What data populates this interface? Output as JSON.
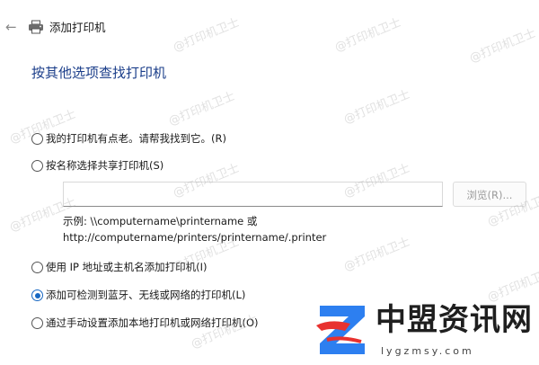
{
  "header": {
    "back_icon": "back-arrow-icon",
    "window_icon": "printer-icon",
    "title": "添加打印机"
  },
  "page_title": "按其他选项查找打印机",
  "options": [
    {
      "label": "我的打印机有点老。请帮我找到它。(R)",
      "checked": false
    },
    {
      "label": "按名称选择共享打印机(S)",
      "checked": false
    },
    {
      "label": "使用 IP 地址或主机名添加打印机(I)",
      "checked": false
    },
    {
      "label": "添加可检测到蓝牙、无线或网络的打印机(L)",
      "checked": true
    },
    {
      "label": "通过手动设置添加本地打印机或网络打印机(O)",
      "checked": false
    }
  ],
  "share_input": {
    "value": ""
  },
  "browse_button": {
    "label": "浏览(R)..."
  },
  "example": {
    "line1": "示例: \\\\computername\\printername 或",
    "line2": "http://computername/printers/printername/.printer"
  },
  "watermark": {
    "text": "@打印机卫士"
  },
  "logo": {
    "name": "中盟资讯网",
    "domain": "lygzmsy.com",
    "colors": {
      "blue": "#2d7ff0",
      "red": "#e8312f"
    }
  }
}
